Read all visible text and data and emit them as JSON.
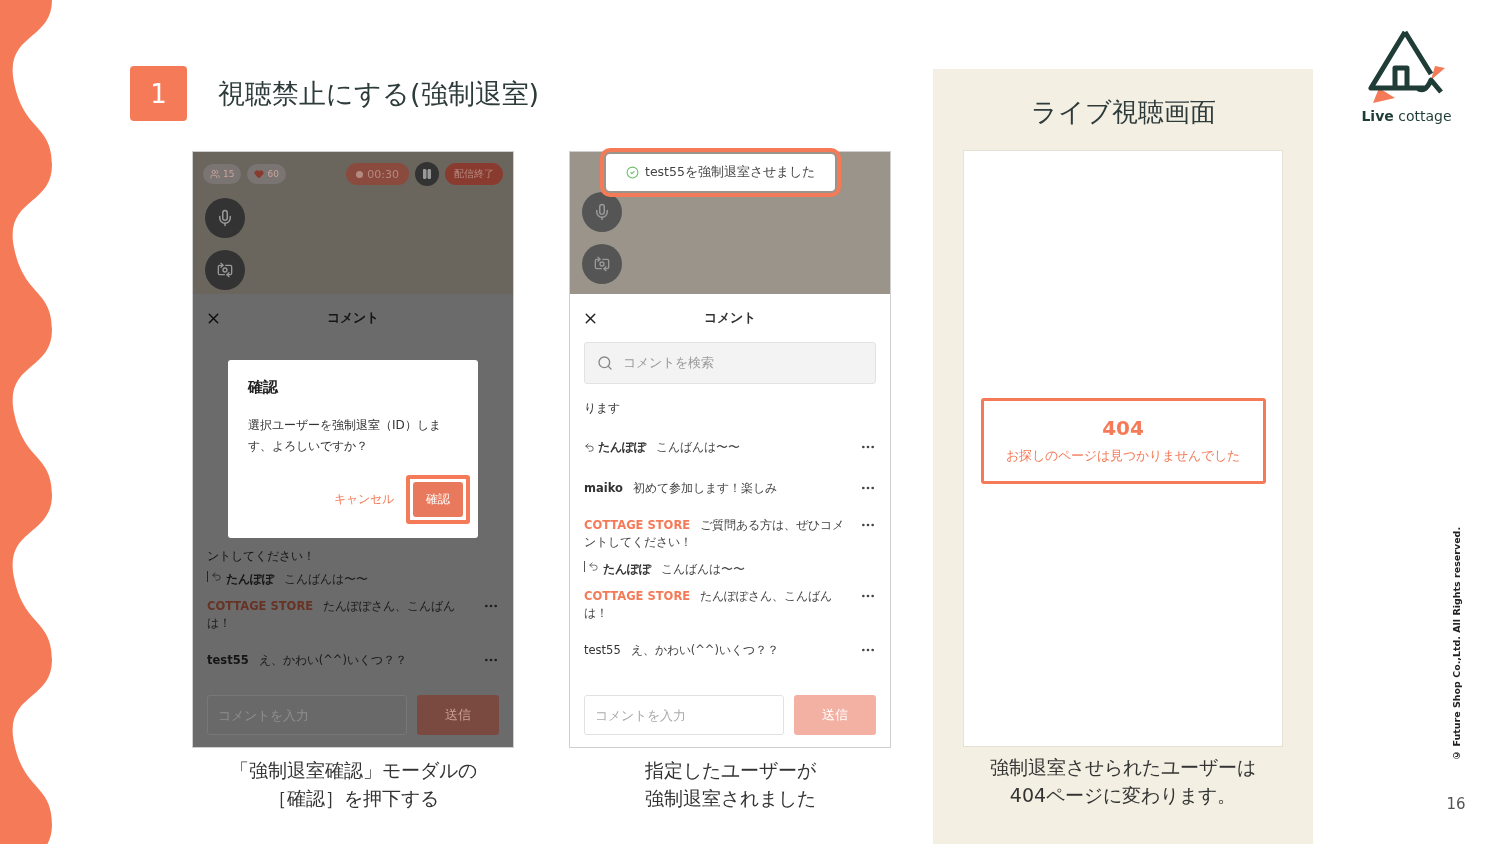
{
  "slide": {
    "step": "1",
    "title": "視聴禁止にする(強制退室)",
    "logo": "**Live** cottage",
    "copyright": "© Future Shop Co.,Ltd. All Rights reserved.",
    "page_number": "16"
  },
  "phones": [
    {
      "dimmed": true,
      "stream": {
        "viewers": "15",
        "likes": "60",
        "timer": "00:30",
        "end_label": "配信終了"
      },
      "comments_title": "コメント",
      "modal": {
        "title": "確認",
        "message": "選択ユーザーを強制退室（ID）します、よろしいですか？",
        "cancel": "キャンセル",
        "confirm": "確認",
        "highlighted": true
      },
      "comments": [
        {
          "kind": "fragment",
          "text": "ントしてください！"
        },
        {
          "kind": "quote",
          "author": "たんぽぽ",
          "text": "こんばんは〜〜"
        },
        {
          "kind": "store",
          "author": "COTTAGE STORE",
          "text": "たんぽぽさん、こんばんは！"
        },
        {
          "kind": "user",
          "author": "test55",
          "text": "え、かわい(^^)いくつ？？"
        }
      ],
      "input_placeholder": "コメントを入力",
      "send_label": "送信",
      "caption": [
        "「強制退室確認」モーダルの",
        "［確認］を押下する"
      ]
    },
    {
      "dimmed": false,
      "toast": {
        "text": "test55を強制退室させました",
        "highlighted": true
      },
      "comments_title": "コメント",
      "search_placeholder": "コメントを検索",
      "comments": [
        {
          "kind": "fragment",
          "text": "ります"
        },
        {
          "kind": "reply",
          "author": "たんぽぽ",
          "text": "こんばんは〜〜"
        },
        {
          "kind": "user",
          "author": "maiko",
          "text": "初めて参加します！楽しみ"
        },
        {
          "kind": "store",
          "author": "COTTAGE STORE",
          "text": "ご質問ある方は、ぜひコメントしてください！"
        },
        {
          "kind": "quote",
          "author": "たんぽぽ",
          "text": "こんばんは〜〜"
        },
        {
          "kind": "store",
          "author": "COTTAGE STORE",
          "text": "たんぽぽさん、こんばんは！"
        },
        {
          "kind": "removed",
          "author": "test55",
          "text": "え、かわい(^^)いくつ？？"
        }
      ],
      "input_placeholder": "コメントを入力",
      "send_label": "送信",
      "caption": [
        "指定したユーザーが",
        "強制退室されました"
      ]
    }
  ],
  "viewer_panel": {
    "title": "ライブ視聴画面",
    "error_code": "404",
    "error_message": "お探しのページは見つかりませんでした",
    "highlighted": true,
    "caption": [
      "強制退室させられたユーザーは",
      "404ページに変わります。"
    ]
  }
}
